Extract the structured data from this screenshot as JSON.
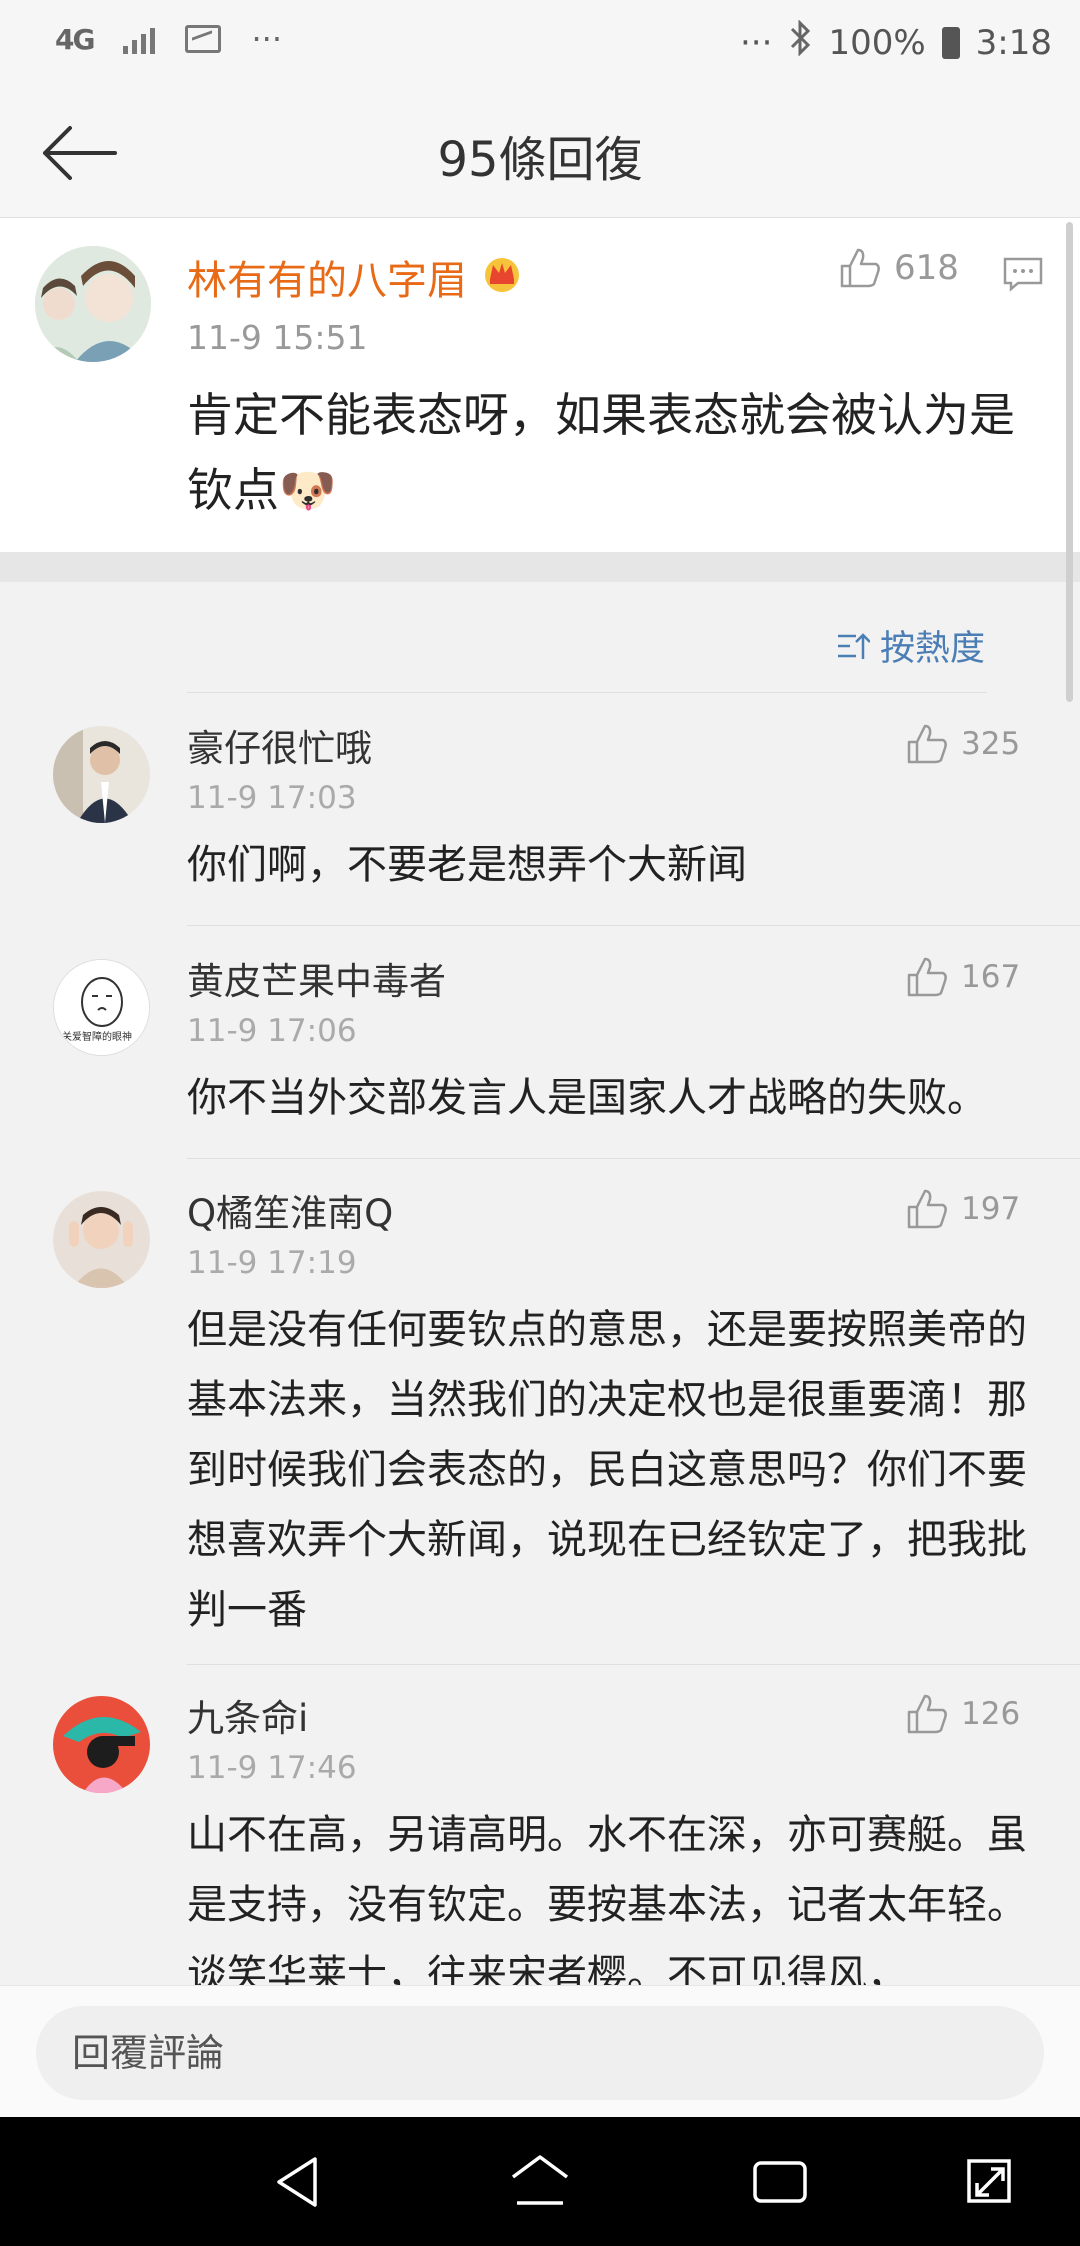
{
  "status_bar": {
    "network": "4G",
    "more_left": "···",
    "more_right": "···",
    "battery": "100%",
    "time": "3:18"
  },
  "header": {
    "title": "95條回復"
  },
  "main_post": {
    "author": "林有有的八字眉",
    "time": "11-9 15:51",
    "text": "肯定不能表态呀，如果表态就会被认为是钦点🐶",
    "likes": "618"
  },
  "sort": {
    "label": "按熱度"
  },
  "replies": [
    {
      "author": "豪仔很忙哦",
      "time": "11-9 17:03",
      "text": "你们啊，不要老是想弄个大新闻",
      "likes": "325"
    },
    {
      "author": "黄皮芒果中毒者",
      "time": "11-9 17:06",
      "text": "你不当外交部发言人是国家人才战略的失败。",
      "likes": "167"
    },
    {
      "author": "Q橘笙淮南Q",
      "time": "11-9 17:19",
      "text": "但是没有任何要钦点的意思，还是要按照美帝的基本法来，当然我们的决定权也是很重要滴！那到时候我们会表态的，民白这意思吗？你们不要想喜欢弄个大新闻，说现在已经钦定了，把我批判一番",
      "likes": "197"
    },
    {
      "author": "九条命i",
      "time": "11-9 17:46",
      "text": "山不在高，另请高明。水不在深，亦可赛艇。虽是支持，没有钦定。要按基本法，记者太年轻。谈笑华莱士，往来宋者樱。不可见得风，",
      "likes": "126"
    }
  ],
  "reply_box": {
    "placeholder": "回覆評論"
  },
  "colors": {
    "accent_name": "#e86a16",
    "sort_blue": "#4a7eb4"
  }
}
